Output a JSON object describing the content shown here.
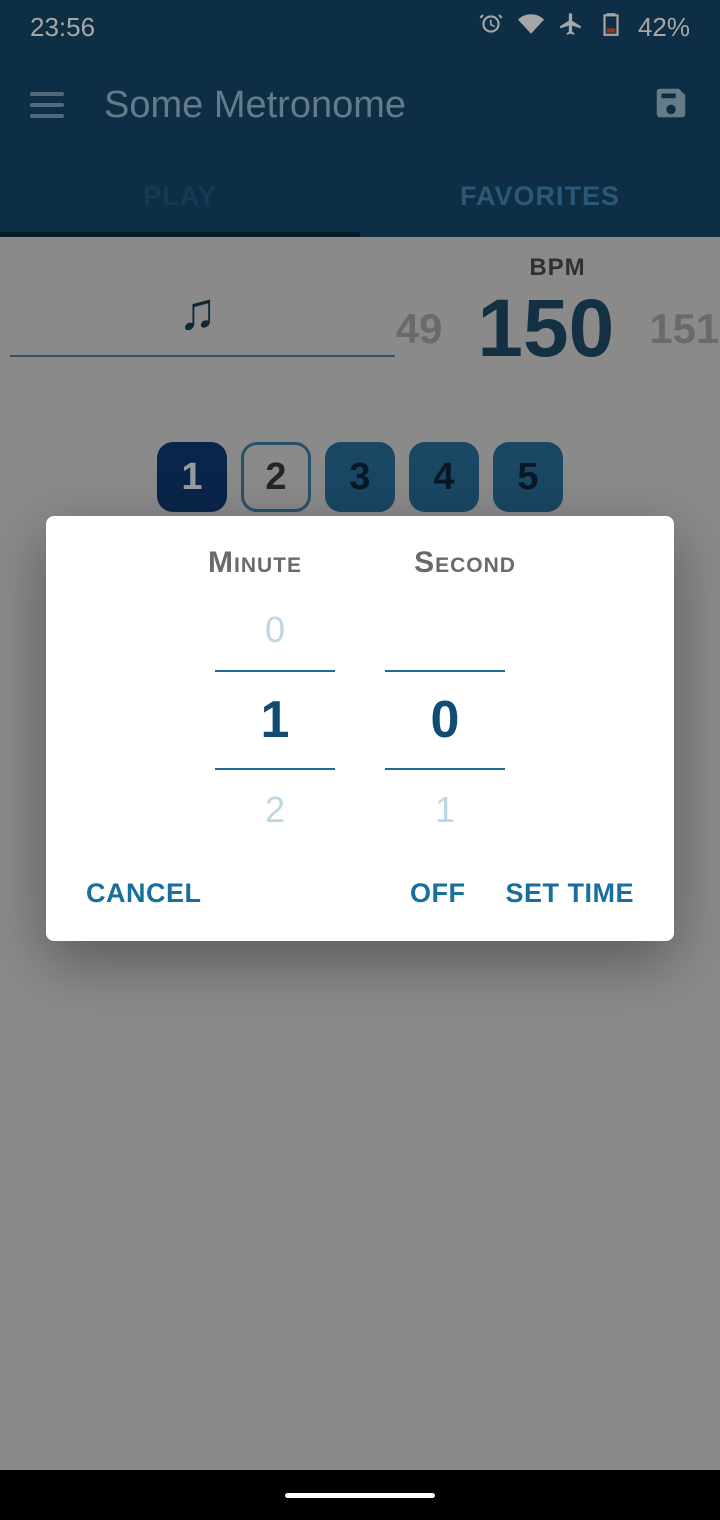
{
  "status": {
    "time": "23:56",
    "battery_pct": "42%"
  },
  "app": {
    "title": "Some Metronome"
  },
  "tabs": {
    "play": "PLAY",
    "favorites": "FAVORITES",
    "active": "play"
  },
  "bpm": {
    "label": "BPM",
    "prev": "49",
    "current": "150",
    "next": "151"
  },
  "beats": [
    "1",
    "2",
    "3",
    "4",
    "5"
  ],
  "dialog": {
    "minute_label": "Minute",
    "second_label": "Second",
    "minute": {
      "prev": "0",
      "selected": "1",
      "next": "2"
    },
    "second": {
      "prev": "",
      "selected": "0",
      "next": "1"
    },
    "actions": {
      "cancel": "CANCEL",
      "off": "OFF",
      "set_time": "SET TIME"
    }
  }
}
